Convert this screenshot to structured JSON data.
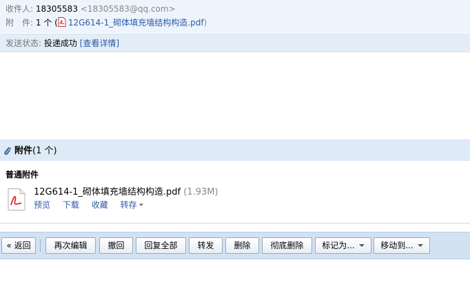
{
  "header": {
    "recipient_label": "收件人:",
    "recipient_name": "18305583",
    "recipient_email": "<18305583@qq.com>",
    "attachment_label": "附　件:",
    "attachment_count": "1 个 (",
    "attachment_file": "12G614-1_砌体填充墙结构构造.pdf",
    "attachment_close": ")"
  },
  "status": {
    "label": "发送状态:",
    "value": "投递成功",
    "detail_link": "[查看详情]"
  },
  "attachments": {
    "title": "附件",
    "count": "(1 个)",
    "group_title": "普通附件",
    "file": {
      "name": "12G614-1_砌体填充墙结构构造.pdf",
      "size": "(1.93M)",
      "actions": {
        "preview": "预览",
        "download": "下载",
        "favorite": "收藏",
        "save_to": "转存"
      }
    }
  },
  "toolbar": {
    "back": "« 返回",
    "edit_again": "再次编辑",
    "recall": "撤回",
    "reply_all": "回复全部",
    "forward": "转发",
    "delete": "删除",
    "delete_permanently": "彻底删除",
    "mark_as": "标记为...",
    "move_to": "移动到..."
  },
  "colors": {
    "link": "#2b5ba8",
    "header_bg": "#eef4fb",
    "toolbar_bg": "#d3e2f3",
    "pdf_red": "#d8262b"
  }
}
